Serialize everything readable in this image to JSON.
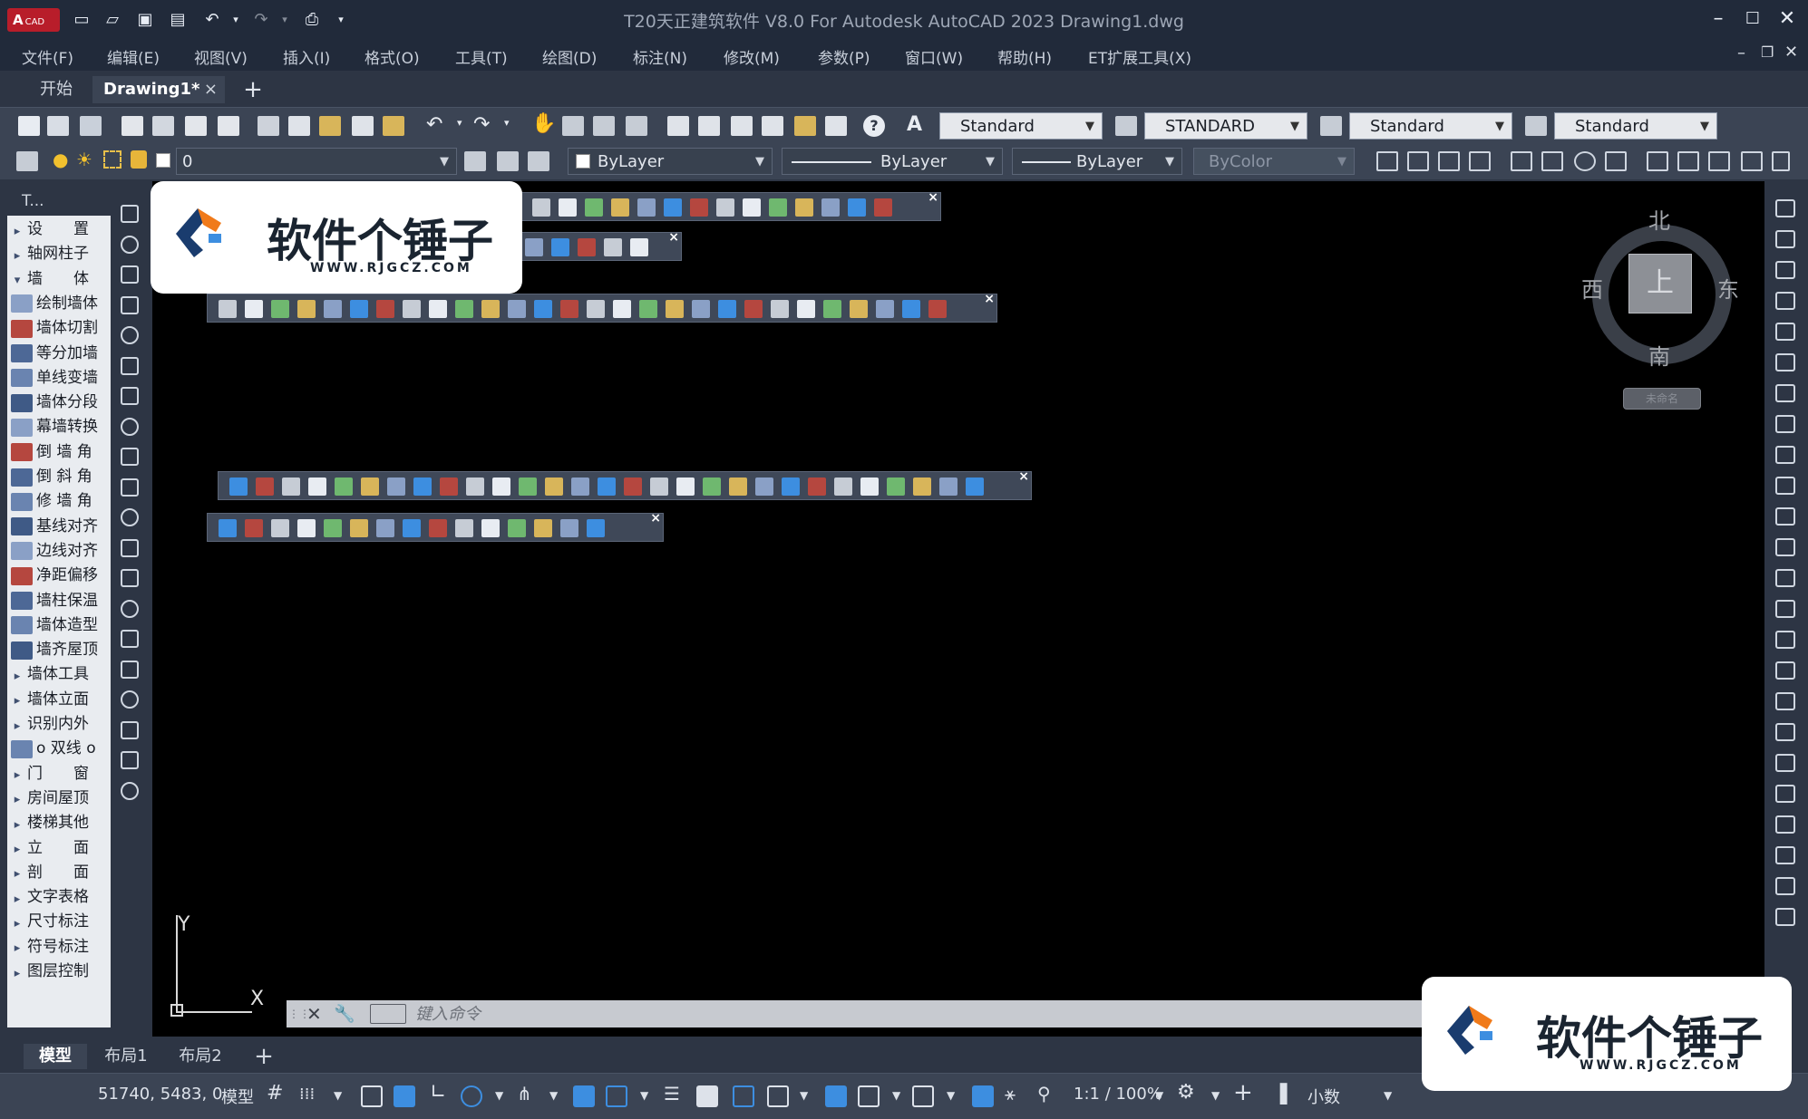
{
  "app": {
    "logo_text": "A",
    "logo_sub": "CAD",
    "window_title": "T20天正建筑软件 V8.0 For Autodesk AutoCAD 2023    Drawing1.dwg"
  },
  "menu": [
    "文件(F)",
    "编辑(E)",
    "视图(V)",
    "插入(I)",
    "格式(O)",
    "工具(T)",
    "绘图(D)",
    "标注(N)",
    "修改(M)",
    "参数(P)",
    "窗口(W)",
    "帮助(H)",
    "ET扩展工具(X)"
  ],
  "tabs": {
    "start": "开始",
    "drawing": "Drawing1*",
    "close": "×",
    "new": "+"
  },
  "toolbar1": {
    "text_style": "Standard",
    "dim_style": "STANDARD",
    "table_style": "Standard",
    "mleader_style": "Standard"
  },
  "toolbar2": {
    "layer": "0",
    "color": "ByLayer",
    "linetype": "ByLayer",
    "lineweight": "ByLayer",
    "plotstyle": "ByColor"
  },
  "palette": {
    "title": "T...",
    "items": [
      {
        "chev": "▸",
        "label": "设　　置"
      },
      {
        "chev": "▸",
        "label": "轴网柱子"
      },
      {
        "chev": "▾",
        "label": "墙　　体"
      },
      {
        "chev": "",
        "label": "绘制墙体"
      },
      {
        "chev": "",
        "label": "墙体切割"
      },
      {
        "chev": "",
        "label": "等分加墙"
      },
      {
        "chev": "",
        "label": "单线变墙"
      },
      {
        "chev": "",
        "label": "墙体分段"
      },
      {
        "chev": "",
        "label": "幕墙转换"
      },
      {
        "chev": "",
        "label": "倒 墙 角"
      },
      {
        "chev": "",
        "label": "倒 斜 角"
      },
      {
        "chev": "",
        "label": "修 墙 角"
      },
      {
        "chev": "",
        "label": "基线对齐"
      },
      {
        "chev": "",
        "label": "边线对齐"
      },
      {
        "chev": "",
        "label": "净距偏移"
      },
      {
        "chev": "",
        "label": "墙柱保温"
      },
      {
        "chev": "",
        "label": "墙体造型"
      },
      {
        "chev": "",
        "label": "墙齐屋顶"
      },
      {
        "chev": "▸",
        "label": "墙体工具"
      },
      {
        "chev": "▸",
        "label": "墙体立面"
      },
      {
        "chev": "▸",
        "label": "识别内外"
      },
      {
        "chev": "",
        "label": "o 双线 o"
      },
      {
        "chev": "▸",
        "label": "门　　窗"
      },
      {
        "chev": "▸",
        "label": "房间屋顶"
      },
      {
        "chev": "▸",
        "label": "楼梯其他"
      },
      {
        "chev": "▸",
        "label": "立　　面"
      },
      {
        "chev": "▸",
        "label": "剖　　面"
      },
      {
        "chev": "▸",
        "label": "文字表格"
      },
      {
        "chev": "▸",
        "label": "尺寸标注"
      },
      {
        "chev": "▸",
        "label": "符号标注"
      },
      {
        "chev": "▸",
        "label": "图层控制"
      }
    ]
  },
  "viewcube": {
    "face": "上",
    "north": "北",
    "south": "南",
    "east": "东",
    "west": "西",
    "wcs": "未命名"
  },
  "ucs": {
    "x": "X",
    "y": "Y"
  },
  "command": {
    "placeholder": "键入命令"
  },
  "layout_tabs": [
    "模型",
    "布局1",
    "布局2",
    "+"
  ],
  "status": {
    "coords": "51740, 5483, 0",
    "model": "模型",
    "scale": "1:1 / 100%",
    "units": "小数"
  },
  "watermark": {
    "text": "软件个锤子",
    "url": "WWW.RJGCZ.COM"
  },
  "colors": {
    "titlebar": "#212a3a",
    "panel": "#2d3544",
    "toolbar": "#3b4454",
    "canvas": "#000000",
    "accent_blue": "#3d8ee0",
    "logo_red": "#b81d2a",
    "watermark_orange": "#f07a1a",
    "watermark_navy": "#1a3c6e"
  }
}
